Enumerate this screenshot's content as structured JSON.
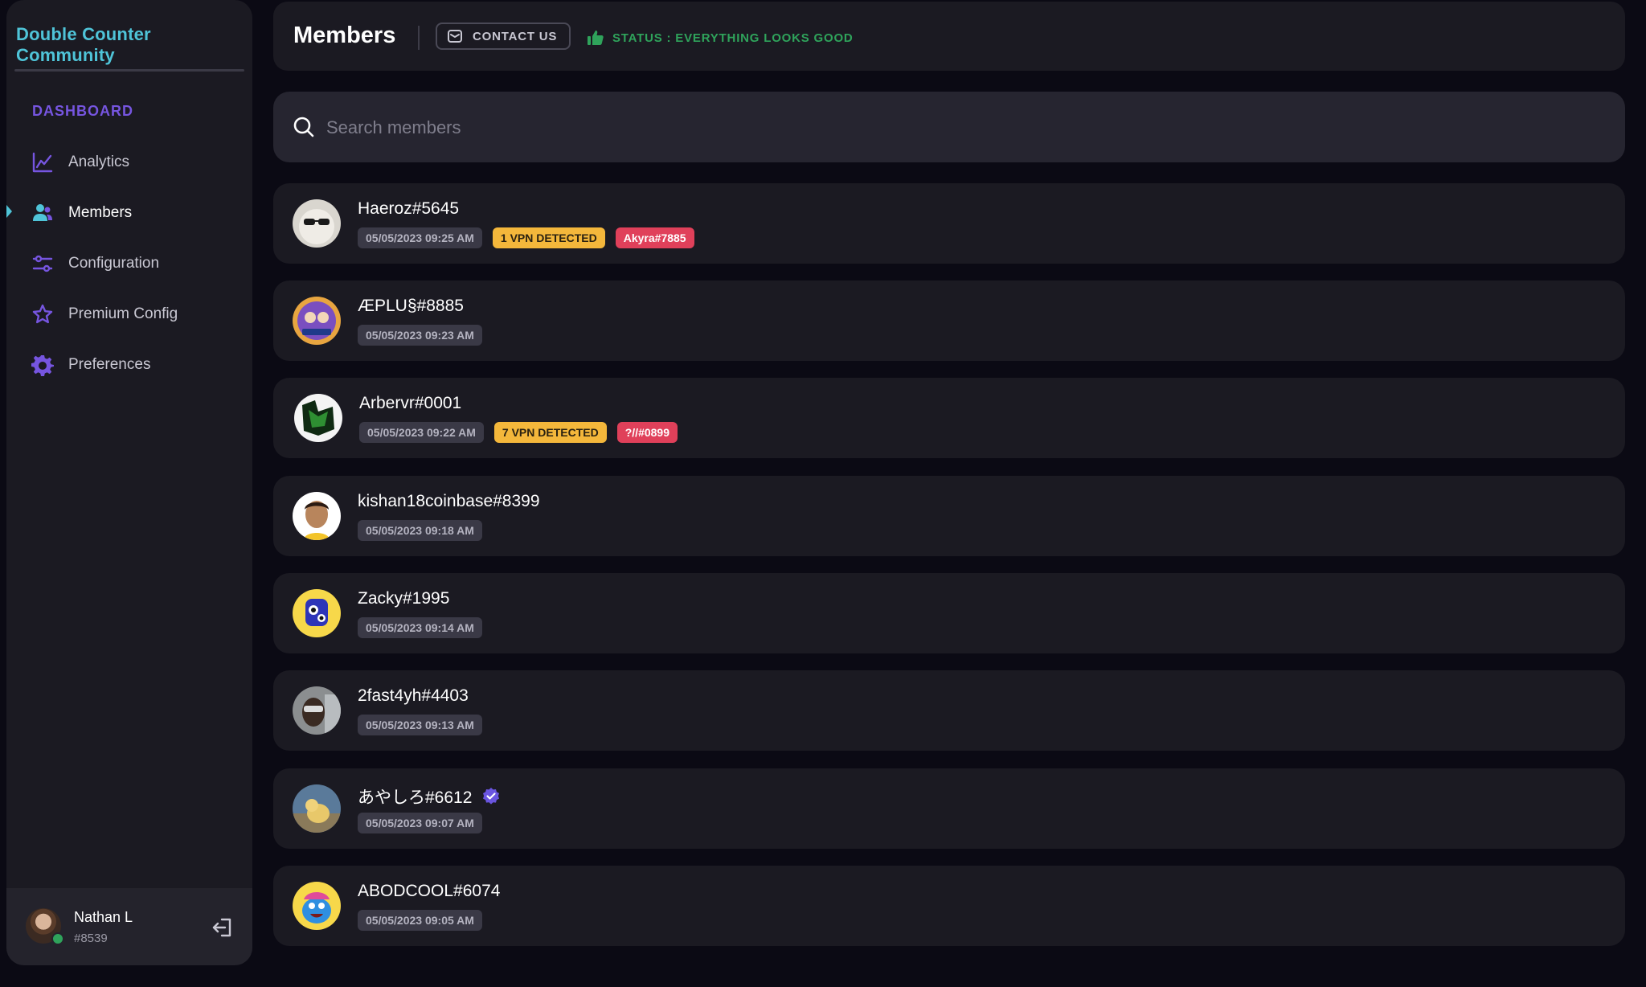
{
  "sidebar": {
    "brand": "Double Counter Community",
    "section_label": "DASHBOARD",
    "items": [
      {
        "label": "Analytics",
        "icon": "analytics-icon"
      },
      {
        "label": "Members",
        "icon": "members-icon",
        "active": true
      },
      {
        "label": "Configuration",
        "icon": "sliders-icon"
      },
      {
        "label": "Premium Config",
        "icon": "star-icon"
      },
      {
        "label": "Preferences",
        "icon": "gear-icon"
      }
    ],
    "user": {
      "name": "Nathan L",
      "tag": "#8539",
      "status": "online"
    }
  },
  "header": {
    "title": "Members",
    "contact_label": "CONTACT US",
    "status_label": "STATUS : EVERYTHING LOOKS GOOD"
  },
  "search": {
    "placeholder": "Search members",
    "value": ""
  },
  "members": [
    {
      "name": "Haeroz#5645",
      "date": "05/05/2023 09:25 AM",
      "vpn": "1 VPN DETECTED",
      "alt": "Akyra#7885"
    },
    {
      "name": "ÆPLU§#8885",
      "date": "05/05/2023 09:23 AM"
    },
    {
      "name": "Arbervr#0001",
      "date": "05/05/2023 09:22 AM",
      "vpn": "7 VPN DETECTED",
      "alt": "?//#0899"
    },
    {
      "name": "kishan18coinbase#8399",
      "date": "05/05/2023 09:18 AM"
    },
    {
      "name": "Zacky#1995",
      "date": "05/05/2023 09:14 AM"
    },
    {
      "name": "2fast4yh#4403",
      "date": "05/05/2023 09:13 AM"
    },
    {
      "name": "あやしろ#6612",
      "date": "05/05/2023 09:07 AM",
      "verified": true
    },
    {
      "name": "ABODCOOL#6074",
      "date": "05/05/2023 09:05 AM"
    }
  ],
  "colors": {
    "background": "#0b0a14",
    "panel": "#1b1a22",
    "accent_purple": "#7655e0",
    "accent_cyan": "#4fc4d8",
    "status_green": "#2fa35b",
    "vpn_tag": "#f4b73b",
    "alt_tag": "#e0405a"
  }
}
